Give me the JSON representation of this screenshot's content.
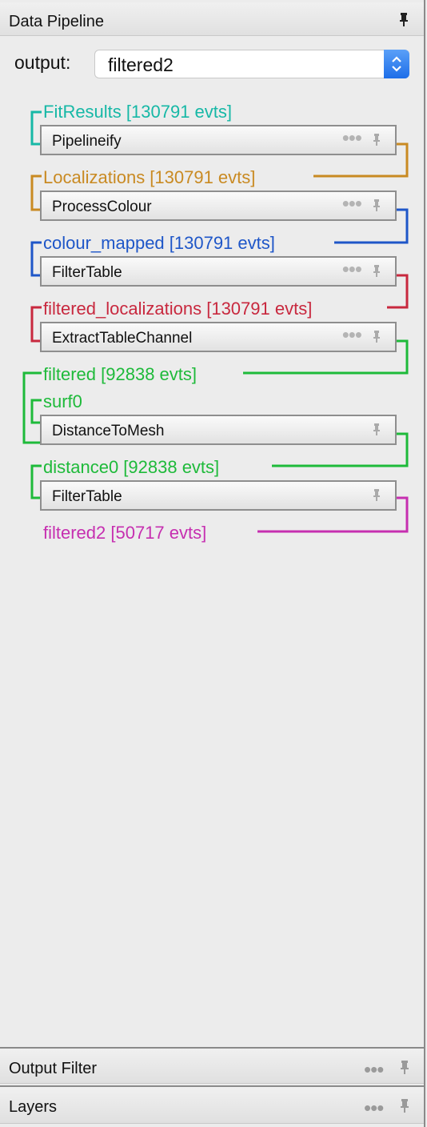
{
  "panel": {
    "title": "Data Pipeline",
    "output_label": "output:",
    "output_value": "filtered2"
  },
  "pipeline": {
    "labels": [
      {
        "text": "FitResults [130791 evts]",
        "color": "#16b8a6"
      },
      {
        "text": "Localizations [130791 evts]",
        "color": "#c98a22"
      },
      {
        "text": "colour_mapped [130791 evts]",
        "color": "#1e56c8"
      },
      {
        "text": "filtered_localizations [130791 evts]",
        "color": "#c8283e"
      },
      {
        "text": "filtered [92838 evts]",
        "color": "#1eba3a"
      },
      {
        "text": "surf0",
        "color": "#1eba3a"
      },
      {
        "text": "distance0 [92838 evts]",
        "color": "#1eba3a"
      },
      {
        "text": "filtered2 [50717 evts]",
        "color": "#c62fb0"
      }
    ],
    "nodes": [
      {
        "name": "Pipelineify",
        "has_dots": true
      },
      {
        "name": "ProcessColour",
        "has_dots": true
      },
      {
        "name": "FilterTable",
        "has_dots": true
      },
      {
        "name": "ExtractTableChannel",
        "has_dots": true
      },
      {
        "name": "DistanceToMesh",
        "has_dots": false
      },
      {
        "name": "FilterTable",
        "has_dots": false
      }
    ]
  },
  "bottom_panels": [
    {
      "title": "Output Filter"
    },
    {
      "title": "Layers"
    }
  ],
  "icons": {
    "pin": "pin-icon",
    "more": "more-dots-icon",
    "stepper": "select-stepper-icon"
  }
}
